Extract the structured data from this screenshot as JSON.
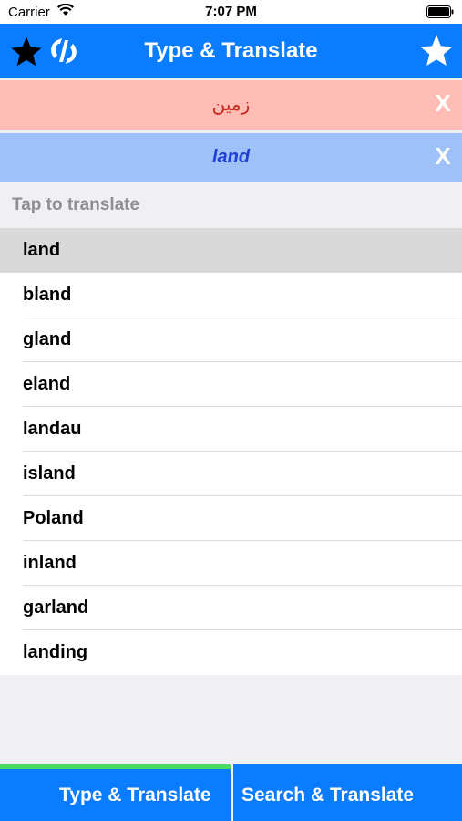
{
  "status_bar": {
    "carrier": "Carrier",
    "time": "7:07 PM"
  },
  "header": {
    "title": "Type & Translate"
  },
  "source": {
    "text": "زمین",
    "clear_label": "X"
  },
  "target": {
    "text": "land",
    "clear_label": "X"
  },
  "suggestions": {
    "header": "Tap to translate",
    "items": [
      "land",
      "bland",
      "gland",
      "eland",
      "landau",
      "island",
      "Poland",
      "inland",
      "garland",
      "landing"
    ]
  },
  "tabs": [
    {
      "label": "Type & Translate",
      "active": true
    },
    {
      "label": "Search & Translate",
      "active": false
    }
  ],
  "colors": {
    "accent": "#0a7cff",
    "source_bg": "#ffbdb5",
    "target_bg": "#9ec2f8",
    "active_tab_indicator": "#4cd964"
  }
}
